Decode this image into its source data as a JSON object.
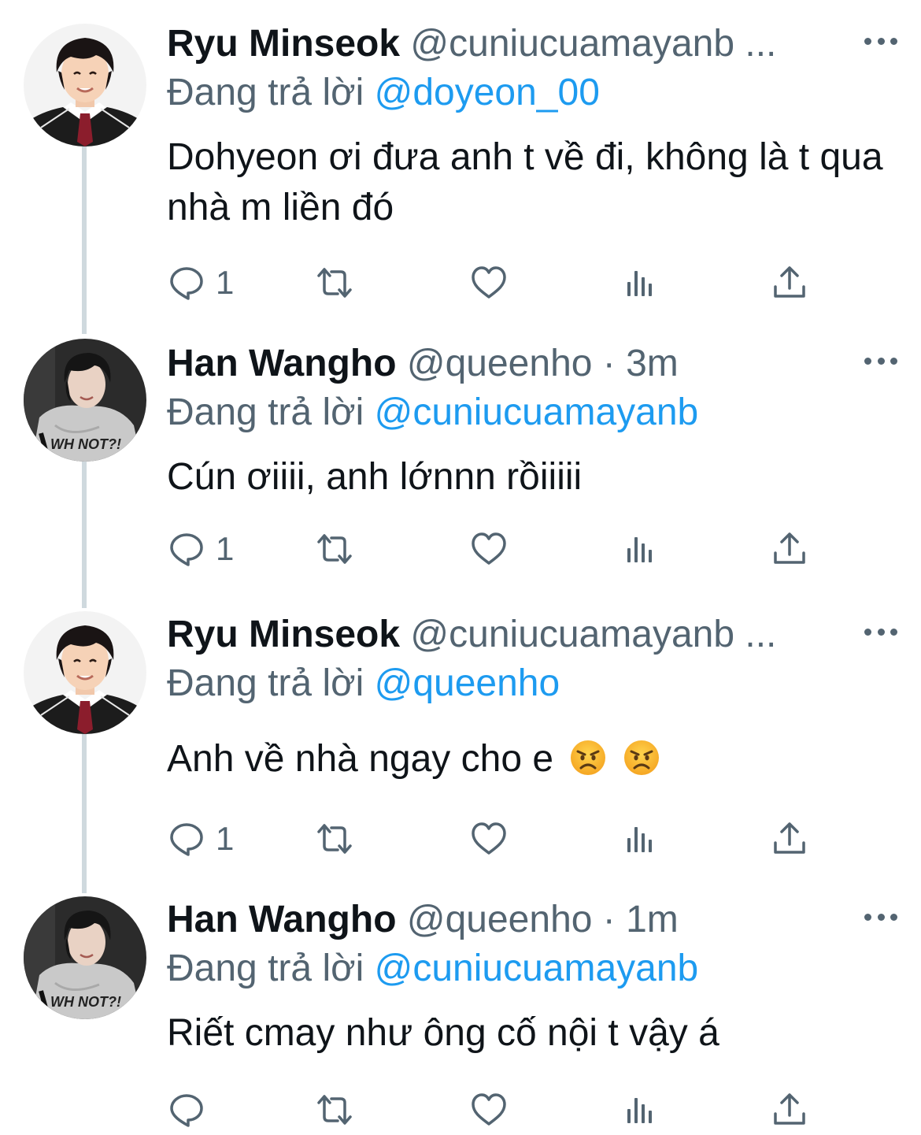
{
  "tweets": [
    {
      "name": "Ryu Minseok",
      "handle": "@cuniucuamayanb ...",
      "reply_prefix": "Đang trả lời",
      "reply_to": "@doyeon_00",
      "text": "Dohyeon ơi đưa anh t về đi, không là t qua nhà m liền đó",
      "reply_count": "1",
      "avatar": "avatar-minseok"
    },
    {
      "name": "Han Wangho",
      "handle": "@queenho · 3m",
      "reply_prefix": "Đang trả lời",
      "reply_to": "@cuniucuamayanb",
      "text": "Cún ơiiii, anh lớnnn rồiiiii",
      "reply_count": "1",
      "avatar": "avatar-wangho"
    },
    {
      "name": "Ryu Minseok",
      "handle": "@cuniucuamayanb ...",
      "reply_prefix": "Đang trả lời",
      "reply_to": "@queenho",
      "text": "Anh về nhà ngay cho e",
      "emojis": [
        "angry-face-emoji",
        "angry-face-emoji"
      ],
      "reply_count": "1",
      "avatar": "avatar-minseok"
    },
    {
      "name": "Han Wangho",
      "handle": "@queenho · 1m",
      "reply_prefix": "Đang trả lời",
      "reply_to": "@cuniucuamayanb",
      "text": "Riết cmay như ông cố nội t vậy á",
      "reply_count": "",
      "avatar": "avatar-wangho"
    }
  ],
  "action_icons": [
    "reply-icon",
    "retweet-icon",
    "like-icon",
    "views-icon",
    "share-icon"
  ],
  "colors": {
    "text": "#0f1419",
    "secondary": "#536471",
    "link": "#1d9bf0",
    "thread_line": "#cfd9de"
  }
}
